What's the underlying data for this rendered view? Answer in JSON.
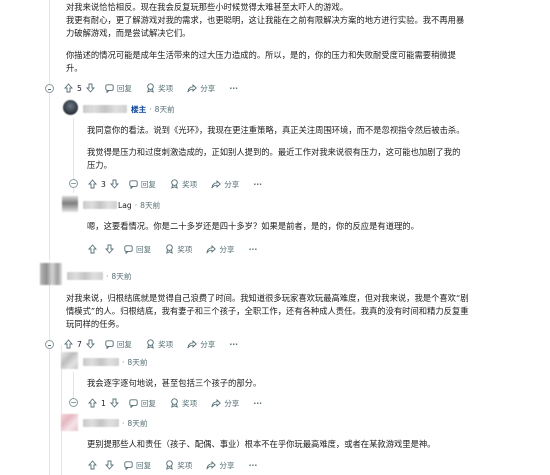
{
  "comments": [
    {
      "id": "c0",
      "paragraphs": [
        [
          "对我来说恰恰相反。现在我会反复玩那些小时候觉得太难甚至太吓人的游戏。"
        ],
        [
          "我更有耐心，更了解游戏对我的需求，也更聪明，这让我能在之前有限解决方案的地方进行实验。我不再用暴",
          "力破解游戏，而是尝试解决它们。"
        ],
        [
          "你描述的情况可能是成年生活带来的过大压力造成的。所以，是的，你的压力和失败耐受度可能需要稍微提",
          "升。"
        ]
      ],
      "votes": "5",
      "actions": {
        "reply": "回复",
        "award": "奖项",
        "share": "分享"
      },
      "more": "···"
    },
    {
      "id": "c1",
      "op_badge": "楼主",
      "time": "8天前",
      "paragraphs": [
        [
          "我同意你的看法。说到《光环》，我现在更注重策略，真正关注周围环境，而不是忽视指令然后被击杀。"
        ],
        [
          "我觉得是压力和过度刺激造成的，正如别人提到的。最近工作对我来说很有压力，这可能也加剧了我的",
          "压力。"
        ]
      ],
      "votes": "3",
      "actions": {
        "reply": "回复",
        "award": "奖项",
        "share": "分享"
      },
      "more": "···"
    },
    {
      "id": "c2",
      "user_suffix": "Lag",
      "time": "8天前",
      "paragraphs": [
        [
          "嗯，这要看情况。你是二十多岁还是四十多岁？如果是前者，是的，你的反应是有道理的。"
        ]
      ],
      "votes": "",
      "actions": {
        "reply": "回复",
        "award": "奖项",
        "share": "分享"
      },
      "more": "···"
    },
    {
      "id": "c3",
      "time": "8天前",
      "paragraphs": [
        [
          "对我来说，归根结底就是觉得自己浪费了时间。我知道很多玩家喜欢玩最高难度，但对我来说，我是个喜欢“剧",
          "情模式”的人。归根结底，我有妻子和三个孩子，全职工作，还有各种成人责任。我真的没有时间和精力反复重",
          "玩同样的任务。"
        ]
      ],
      "votes": "7",
      "actions": {
        "reply": "回复",
        "award": "奖项",
        "share": "分享"
      },
      "more": "···"
    },
    {
      "id": "c4",
      "time": "8天前",
      "paragraphs": [
        [
          "我会逐字逐句地说，甚至包括三个孩子的部分。"
        ]
      ],
      "votes": "1",
      "actions": {
        "reply": "回复",
        "award": "奖项",
        "share": "分享"
      },
      "more": "···"
    },
    {
      "id": "c5",
      "time": "8天前",
      "paragraphs": [
        [
          "更别提那些人和责任（孩子、配偶、事业）根本不在乎你玩最高难度，或者在某款游戏里是神。"
        ]
      ],
      "votes": "",
      "actions": {
        "reply": "回复",
        "award": "奖项",
        "share": "分享"
      },
      "more": "···"
    }
  ]
}
